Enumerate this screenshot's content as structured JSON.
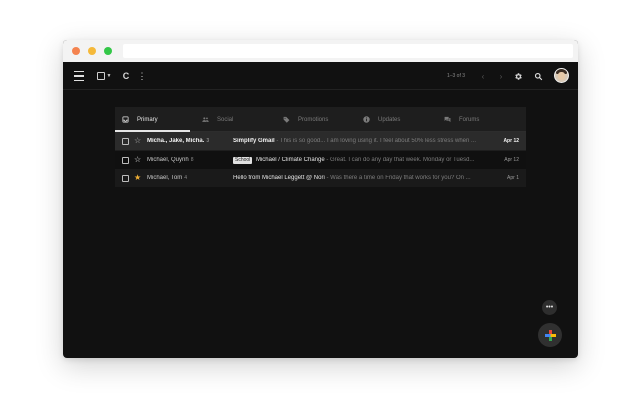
{
  "window": {
    "traffic_lights": [
      "#f4834f",
      "#f5b93a",
      "#33c748"
    ]
  },
  "toolbar": {
    "menu_icon": "hamburger-icon",
    "select_icon": "checkbox-icon",
    "refresh_glyph": "C",
    "more_glyph": "⋮",
    "counter_text": "1–3 of 3",
    "prev_glyph": "‹",
    "next_glyph": "›",
    "settings_icon": "gear-icon",
    "search_icon": "search-icon"
  },
  "tabs": [
    {
      "label": "Primary",
      "icon": "inbox-icon",
      "active": true
    },
    {
      "label": "Social",
      "icon": "people-icon",
      "active": false
    },
    {
      "label": "Promotions",
      "icon": "tag-icon",
      "active": false
    },
    {
      "label": "Updates",
      "icon": "info-icon",
      "active": false
    },
    {
      "label": "Forums",
      "icon": "forum-icon",
      "active": false
    }
  ],
  "emails": [
    {
      "sender": "Micha., Jake, Micha.",
      "count": "3",
      "label": "",
      "subject": "Simplify Gmail",
      "snippet": "- This is so good... I am loving using it. I feel about 50% less stress when ...",
      "date": "Apr 12",
      "unread": true,
      "star_color": "#bdbdbd"
    },
    {
      "sender": "Michael, Quynh",
      "count": "8",
      "label": "School",
      "subject": "Michael / Climate Change",
      "snippet": "- Great. I can do any day that week. Monday or Tuesd...",
      "date": "Apr 12",
      "unread": false,
      "star_color": "#e8e8e8"
    },
    {
      "sender": "Michael, Tom",
      "count": "4",
      "label": "",
      "subject": "Hello from Michael Leggett @ Nori",
      "snippet": "- Was there a time on Friday that works for you? On ...",
      "date": "Apr 1",
      "unread": false,
      "star_color": "#f2b135"
    }
  ],
  "fab": {
    "more_glyph": "•••",
    "compose_icon": "plus-icon",
    "plus_colors": [
      "#ea4335",
      "#4285f4",
      "#fbbc05",
      "#34a853"
    ]
  }
}
